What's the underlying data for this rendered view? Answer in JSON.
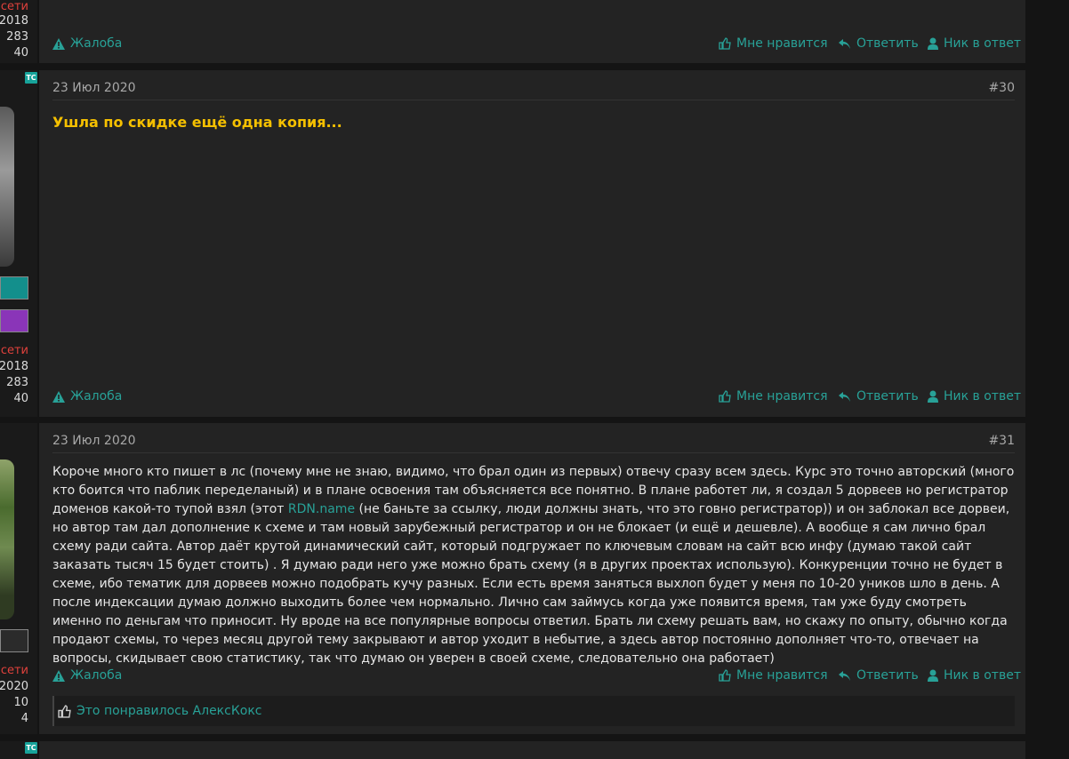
{
  "post_top": {
    "stats": [
      "в сети",
      "2018",
      "283",
      "40"
    ],
    "actions": {
      "report": "Жалоба",
      "like": "Мне нравится",
      "reply": "Ответить",
      "nick": "Ник в ответ"
    }
  },
  "post30": {
    "badge": "ТС",
    "date": "23 Июл 2020",
    "number": "#30",
    "text": "Ушла по скидке ещё одна копия...",
    "stats": [
      "в сети",
      "2018",
      "283",
      "40"
    ],
    "actions": {
      "report": "Жалоба",
      "like": "Мне нравится",
      "reply": "Ответить",
      "nick": "Ник в ответ"
    }
  },
  "post31": {
    "date": "23 Июл 2020",
    "number": "#31",
    "text_before_link": "Короче много кто пишет в лс (почему мне не знаю, видимо, что брал один из первых) отвечу сразу всем здесь. Курс это точно авторский (много кто боится что паблик переделаный) и в плане освоения там объясняется все понятно. В плане работет ли, я создал 5 дорвеев но регистратор доменов какой-то тупой взял (этот ",
    "link": "RDN.name",
    "text_after_link": " (не баньте за ссылку, люди должны знать, что это говно регистратор)) и он заблокал все дорвеи, но автор там дал дополнение к схеме и там новый зарубежный регистратор и он не блокает (и ещё и дешевле). А вообще я сам лично брал схему ради сайта. Автор даёт крутой динамический сайт, который подгружает по ключевым словам на сайт всю инфу (думаю такой сайт заказать тысяч 15 будет стоить) . Я думаю ради него уже можно брать схему (я в других проектах использую). Конкуренции точно не будет в схеме, ибо тематик для дорвеев можно подобрать кучу разных. Если есть время заняться выхлоп будет у меня по 10-20 уников шло в день. А после индексации думаю должно выходить более чем нормально. Лично сам займусь когда уже появится время, там уже буду смотреть именно по деньгам что приносит. Ну вроде на все популярные вопросы ответил. Брать ли схему решать вам, но скажу по опыту, обычно когда продают схемы, то через месяц другой тему закрывают и автор уходит в небытие, а здесь автор постоянно дополняет что-то, отвечает на вопросы, скидывает свою статистику, так что думаю он уверен в своей схеме, следовательно она работает)",
    "stats": [
      "в сети",
      "2020",
      "10",
      "4"
    ],
    "actions": {
      "report": "Жалоба",
      "like": "Мне нравится",
      "reply": "Ответить",
      "nick": "Ник в ответ"
    },
    "liked_by": "Это понравилось АлексКокс"
  },
  "post_next": {
    "badge": "ТС"
  },
  "colors": {
    "accent": "#28a197",
    "highlight": "#f5c000",
    "online": "#e0413c",
    "bg": "#232323"
  }
}
